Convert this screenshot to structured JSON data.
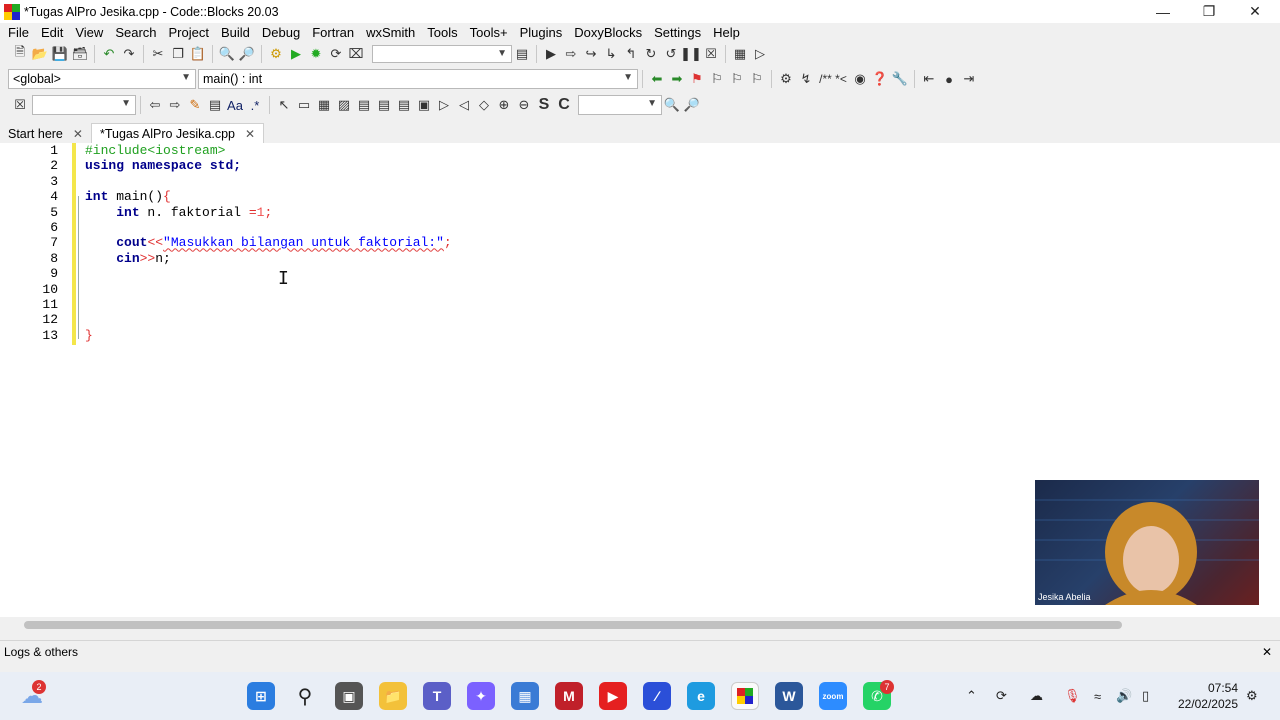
{
  "window": {
    "title": "*Tugas AlPro Jesika.cpp - Code::Blocks 20.03"
  },
  "menu": [
    "File",
    "Edit",
    "View",
    "Search",
    "Project",
    "Build",
    "Debug",
    "Fortran",
    "wxSmith",
    "Tools",
    "Tools+",
    "Plugins",
    "DoxyBlocks",
    "Settings",
    "Help"
  ],
  "codecompletion": {
    "scope": "<global>",
    "symbol": "main() : int"
  },
  "search_toolbar": {
    "text": "",
    "doxy": "/** *<"
  },
  "tabs": [
    {
      "label": "Start here"
    },
    {
      "label": "*Tugas AlPro Jesika.cpp"
    }
  ],
  "editor": {
    "line_numbers": [
      "1",
      "2",
      "3",
      "4",
      "5",
      "6",
      "7",
      "8",
      "9",
      "10",
      "11",
      "12",
      "13"
    ],
    "lines": {
      "l1": "#include<iostream>",
      "l2_kw1": "using",
      "l2_kw2": "namespace",
      "l2_rest": " std;",
      "l4_kw": "int",
      "l4_rest": " main()",
      "l4_brace": "{",
      "l5_kw": "int",
      "l5_rest": " n. faktorial ",
      "l5_op": "=",
      "l5_num": "1",
      "l5_end": ";",
      "l7_kw": "cout",
      "l7_op": "<<",
      "l7_str": "\"Masukkan bilangan untuk faktorial:\"",
      "l7_end": ";",
      "l8_kw": "cin",
      "l8_op": ">>",
      "l8_rest": "n;",
      "l13": "}"
    }
  },
  "bottom_panel": {
    "title": "Logs & others"
  },
  "webcam": {
    "name": "Jesika Abelia"
  },
  "taskbar": {
    "weather_badge": "2",
    "whatsapp_badge": "7",
    "time": "07:54",
    "date": "22/02/2025"
  },
  "colors": {
    "changebar": "#f4e64a",
    "preprocessor": "#20a020",
    "keyword": "#00008b",
    "string": "#0000ff"
  }
}
